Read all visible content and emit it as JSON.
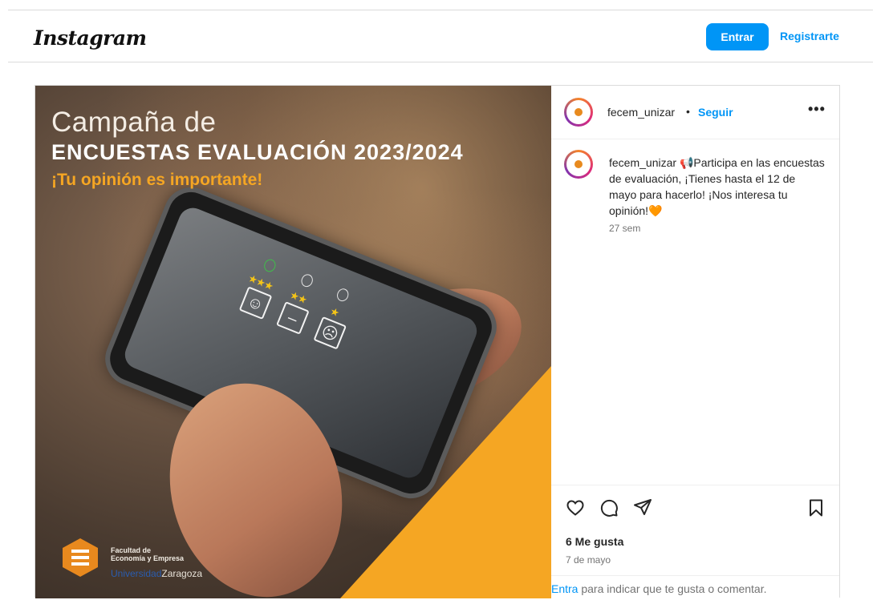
{
  "header": {
    "logo": "Instagram",
    "login_label": "Entrar",
    "signup_label": "Registrarte"
  },
  "media": {
    "title_line1": "Campaña de",
    "title_line2": "ENCUESTAS EVALUACIÓN 2023/2024",
    "title_line3": "¡Tu opinión es importante!",
    "faculty_line1": "Facultad de",
    "faculty_line2": "Economía y Empresa",
    "university_blue": "Universidad",
    "university_rest": "Zaragoza",
    "accent_color": "#f5a623"
  },
  "post": {
    "username": "fecem_unizar",
    "separator": "•",
    "follow_label": "Seguir",
    "more_label": "•••",
    "caption_username": "fecem_unizar",
    "caption_text": "📢Participa en las encuestas de evaluación, ¡Tienes hasta el 12 de mayo para hacerlo! ¡Nos interesa tu opinión!🧡",
    "caption_age": "27 sem",
    "likes": "6 Me gusta",
    "date": "7 de mayo",
    "footer_link": "Entra",
    "footer_text": " para indicar que te gusta o comentar."
  },
  "icons": {
    "like": "heart-icon",
    "comment": "comment-icon",
    "share": "send-icon",
    "save": "bookmark-icon"
  },
  "colors": {
    "primary": "#0095f6",
    "border": "#dbdbdb",
    "muted": "#737373"
  }
}
